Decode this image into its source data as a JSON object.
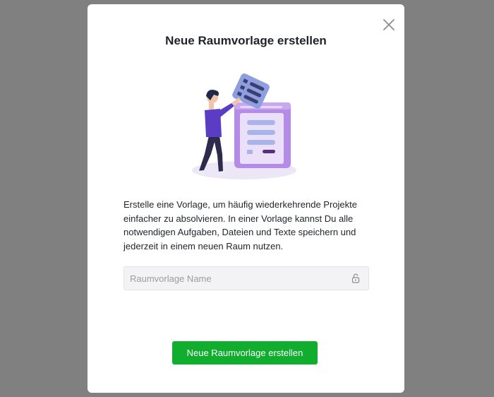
{
  "dialog": {
    "title": "Neue Raumvorlage erstellen",
    "close_icon": "close-icon",
    "illustration": "person-with-template-illustration",
    "description": "Erstelle eine Vorlage, um häufig wiederkehrende Projekte einfacher zu absolvieren. In einer Vorlage kannst Du alle notwendigen Aufgaben, Dateien und Texte speichern und jederzeit in einem neuen Raum nutzen.",
    "name_input": {
      "placeholder": "Raumvorlage Name",
      "value": "",
      "icon": "lock-icon"
    },
    "submit_label": "Neue Raumvorlage erstellen"
  },
  "colors": {
    "overlay": "#808080",
    "primary": "#10ad2f",
    "illustration_purple": "#c9a8ee",
    "illustration_blue": "#8e9ee0"
  }
}
